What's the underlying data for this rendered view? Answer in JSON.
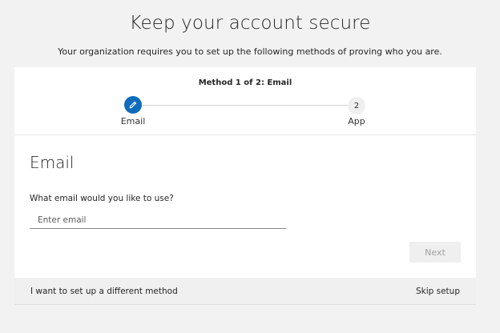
{
  "header": {
    "title": "Keep your account secure",
    "subtitle": "Your organization requires you to set up the following methods of proving who you are."
  },
  "progress": {
    "method_label": "Method 1 of 2: Email",
    "steps": [
      {
        "label": "Email",
        "icon": "pencil-icon",
        "state": "active"
      },
      {
        "label": "App",
        "number": "2",
        "state": "pending"
      }
    ]
  },
  "form": {
    "section_title": "Email",
    "field_label": "What email would you like to use?",
    "email_placeholder": "Enter email",
    "next_label": "Next"
  },
  "footer": {
    "different_method_label": "I want to set up a different method",
    "skip_label": "Skip setup"
  },
  "colors": {
    "accent": "#0f6cbd",
    "page_background": "#f2f2f2",
    "card_background": "#ffffff"
  }
}
